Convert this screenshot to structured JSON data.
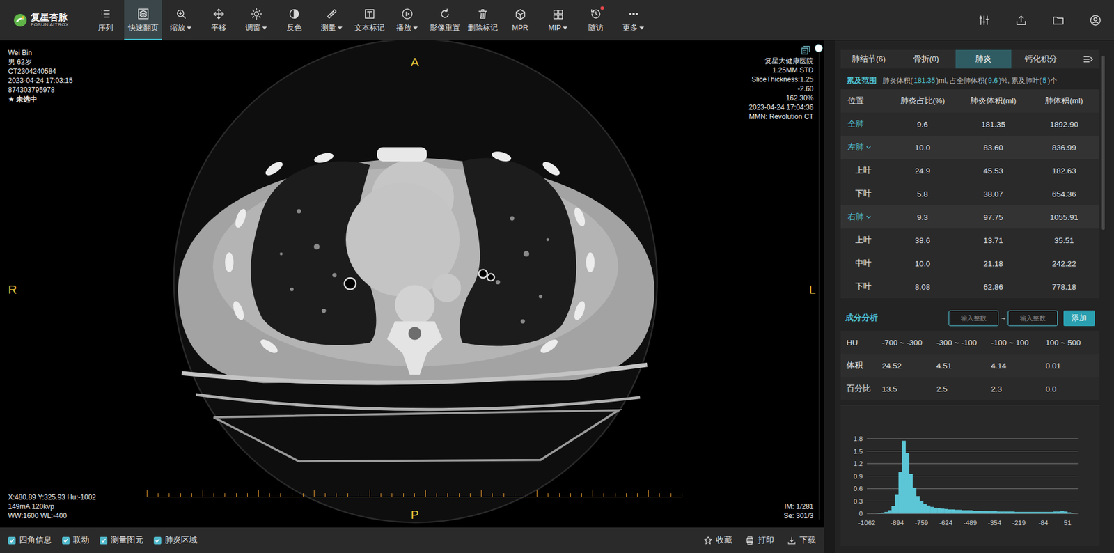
{
  "app": {
    "logo_name": "复星杏脉",
    "logo_sub": "FOSUN AITROX"
  },
  "toolbar": [
    {
      "label": "序列",
      "dropdown": false,
      "selected": false,
      "badge": false
    },
    {
      "label": "快速翻页",
      "dropdown": false,
      "selected": true,
      "badge": false
    },
    {
      "label": "缩放",
      "dropdown": true,
      "selected": false,
      "badge": false
    },
    {
      "label": "平移",
      "dropdown": false,
      "selected": false,
      "badge": false
    },
    {
      "label": "调窗",
      "dropdown": true,
      "selected": false,
      "badge": false
    },
    {
      "label": "反色",
      "dropdown": false,
      "selected": false,
      "badge": false
    },
    {
      "label": "测量",
      "dropdown": true,
      "selected": false,
      "badge": false
    },
    {
      "label": "文本标记",
      "dropdown": false,
      "selected": false,
      "badge": false
    },
    {
      "label": "播放",
      "dropdown": true,
      "selected": false,
      "badge": false
    },
    {
      "label": "影像重置",
      "dropdown": false,
      "selected": false,
      "badge": false
    },
    {
      "label": "删除标记",
      "dropdown": false,
      "selected": false,
      "badge": false
    },
    {
      "label": "MPR",
      "dropdown": false,
      "selected": false,
      "badge": false
    },
    {
      "label": "MIP",
      "dropdown": true,
      "selected": false,
      "badge": false
    },
    {
      "label": "随访",
      "dropdown": false,
      "selected": false,
      "badge": true
    },
    {
      "label": "更多",
      "dropdown": true,
      "selected": false,
      "badge": false
    }
  ],
  "viewer": {
    "top_left": [
      "Wei Bin",
      "男 62岁",
      "CT2304240584",
      "2023-04-24 17:03:15",
      "874303795978"
    ],
    "selection": {
      "icon": "★",
      "label": "未选中"
    },
    "top_right": [
      "复星大健康医院",
      "1.25MM STD",
      "SliceThickness:1.25",
      "-2.60",
      "162.30%",
      "2023-04-24 17:04:36",
      "MMN: Revolution CT"
    ],
    "orientation": {
      "top": "A",
      "bottom": "P",
      "left": "R",
      "right": "L"
    },
    "bottom_left": [
      "X:480.89 Y:325.93 Hu:-1002",
      "149mA 120kvp",
      "WW:1600 WL:-400"
    ],
    "bottom_right": [
      "IM: 1/281",
      "Se: 301/3"
    ],
    "slice_slider": {
      "level": 0
    }
  },
  "panel": {
    "tabs": [
      {
        "label": "肺结节(6)",
        "selected": false
      },
      {
        "label": "骨折(0)",
        "selected": false
      },
      {
        "label": "肺炎",
        "selected": true
      },
      {
        "label": "钙化积分",
        "selected": false
      }
    ],
    "summary": {
      "label": "累及范围",
      "segments": [
        {
          "text": "肺炎体积(",
          "highlight": false
        },
        {
          "text": "181.35",
          "highlight": true
        },
        {
          "text": ")ml, 占全肺体积(",
          "highlight": false
        },
        {
          "text": "9.6",
          "highlight": true
        },
        {
          "text": ")%, 累及肺叶(",
          "highlight": false
        },
        {
          "text": "5",
          "highlight": true
        },
        {
          "text": ")个",
          "highlight": false
        }
      ]
    },
    "table": {
      "columns": [
        "位置",
        "肺炎占比(%)",
        "肺炎体积(ml)",
        "肺体积(ml)"
      ],
      "rows": [
        {
          "kind": "total",
          "label": "全肺",
          "cells": [
            "9.6",
            "181.35",
            "1892.90"
          ]
        },
        {
          "kind": "lung",
          "label": "左肺",
          "expanded": true,
          "cells": [
            "10.0",
            "83.60",
            "836.99"
          ]
        },
        {
          "kind": "lobe",
          "label": "上叶",
          "cells": [
            "24.9",
            "45.53",
            "182.63"
          ]
        },
        {
          "kind": "lobe",
          "label": "下叶",
          "cells": [
            "5.8",
            "38.07",
            "654.36"
          ]
        },
        {
          "kind": "lung",
          "label": "右肺",
          "expanded": true,
          "cells": [
            "9.3",
            "97.75",
            "1055.91"
          ]
        },
        {
          "kind": "lobe",
          "label": "上叶",
          "cells": [
            "38.6",
            "13.71",
            "35.51"
          ]
        },
        {
          "kind": "lobe",
          "label": "中叶",
          "cells": [
            "10.0",
            "21.18",
            "242.22"
          ]
        },
        {
          "kind": "lobe",
          "label": "下叶",
          "cells": [
            "8.08",
            "62.86",
            "778.18"
          ]
        }
      ]
    },
    "composition": {
      "title": "成分分析",
      "inputs": [
        {
          "placeholder": "输入整数"
        },
        {
          "placeholder": "输入整数"
        }
      ],
      "separator": "~",
      "button": "添加",
      "rows": [
        {
          "label": "HU",
          "cells": [
            "-700 ~ -300",
            "-300 ~ -100",
            "-100 ~ 100",
            "100 ~ 500"
          ]
        },
        {
          "label": "体积",
          "cells": [
            "24.52",
            "4.51",
            "4.14",
            "0.01"
          ]
        },
        {
          "label": "百分比",
          "cells": [
            "13.5",
            "2.5",
            "2.3",
            "0.0"
          ]
        }
      ]
    },
    "histogram": {
      "y_ticks": [
        "1.8",
        "1.5",
        "1.2",
        "0.9",
        "0.6",
        "0.3",
        "0"
      ],
      "x_ticks": [
        "-1062",
        "-894",
        "-759",
        "-624",
        "-489",
        "-354",
        "-219",
        "-84",
        "51"
      ],
      "values": [
        0,
        0,
        0,
        0.01,
        0.02,
        0.04,
        0.08,
        0.18,
        0.45,
        1.0,
        1.75,
        1.45,
        0.95,
        0.62,
        0.42,
        0.3,
        0.23,
        0.19,
        0.16,
        0.14,
        0.13,
        0.12,
        0.11,
        0.1,
        0.1,
        0.09,
        0.09,
        0.08,
        0.08,
        0.08,
        0.07,
        0.07,
        0.07,
        0.06,
        0.06,
        0.06,
        0.06,
        0.05,
        0.05,
        0.05,
        0.05,
        0.05,
        0.04,
        0.04,
        0.04,
        0.04,
        0.04,
        0.04,
        0.04,
        0.04,
        0.04,
        0.04,
        0.04,
        0.05,
        0.05,
        0.06,
        0.05,
        0.03,
        0.01,
        0
      ]
    }
  },
  "bottom_bar": {
    "checkboxes": [
      {
        "label": "四角信息",
        "checked": true
      },
      {
        "label": "联动",
        "checked": true
      },
      {
        "label": "测量图元",
        "checked": true
      },
      {
        "label": "肺炎区域",
        "checked": true
      }
    ],
    "actions": [
      {
        "label": "收藏"
      },
      {
        "label": "打印"
      },
      {
        "label": "下载"
      }
    ]
  }
}
